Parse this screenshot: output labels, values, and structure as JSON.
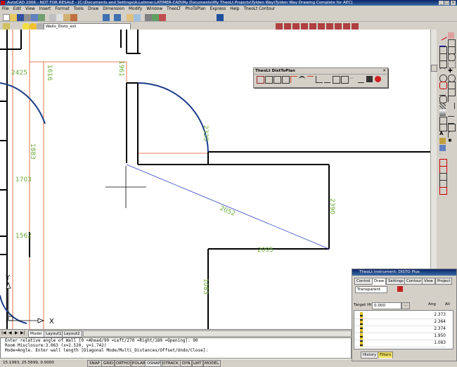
{
  "window": {
    "title": "AutoCAD 2006 - NOT FOR RESALE - [C:\\Documents and Settings\\A.Latimer.LATIMER-CAD\\My Documents\\My TheoLt Projects\\Tylden Way\\Tylden Way Drawing Complete for AEC]"
  },
  "menu": [
    "File",
    "Edit",
    "View",
    "Insert",
    "Format",
    "Tools",
    "Draw",
    "Dimension",
    "Modify",
    "Window",
    "TheoLT",
    "PhoToPlan",
    "Express",
    "Help",
    "TheoLt Contour"
  ],
  "layer_toolbar": {
    "layer_value": "Walls_Disto_ext"
  },
  "drawing": {
    "labels": [
      "1616",
      "1961",
      "2425",
      "2325",
      "2390",
      "2052",
      "2095",
      "1883",
      "1703",
      "1562",
      "1083"
    ],
    "ucs_x": "X",
    "ucs_y": "Y"
  },
  "disttoplan": {
    "title": "TheoLt DistToPlan",
    "close": "✕"
  },
  "tabs": [
    "Model",
    "Layout1",
    "Layout2"
  ],
  "command_lines": [
    "Enter relative angle of Wall [0 =Ahead/90 =Left/270 =Right/180 =Opening]: 90",
    "Room Misclosure:3.063 (x=2.520, y=1.742)",
    "Mode=Angle. Enter wall length [Diagonal Mode/Multi_Distances/Offset/Undo/Close]:"
  ],
  "status": {
    "coords": "15.1993, 25.5699, 0.0000",
    "buttons": [
      "SNAP",
      "GRID",
      "ORTHO",
      "POLAR",
      "OSNAP",
      "OTRACK",
      "DYN",
      "LWT",
      "MODEL"
    ]
  },
  "instrument": {
    "title": "TheoLt Instrument: DISTO Plus",
    "tabs": [
      "Control",
      "Draw",
      "Settings",
      "Contour",
      "View",
      "Project"
    ],
    "mode_value": "Transparent",
    "target_label": "Target Ht:",
    "target_value": "0.000",
    "more_button": "...",
    "ang_label": "Ang",
    "all_label": "All",
    "readings": [
      "2.373",
      "2.364",
      "2.374",
      "1.950",
      "1.083"
    ],
    "bottom_tabs": [
      "History",
      "Filters"
    ]
  },
  "colors": {
    "wall": "#000000",
    "arc": "#1a3a8a",
    "guide": "#e05020",
    "diagonal": "#3040c0",
    "label": "#66aa33"
  }
}
